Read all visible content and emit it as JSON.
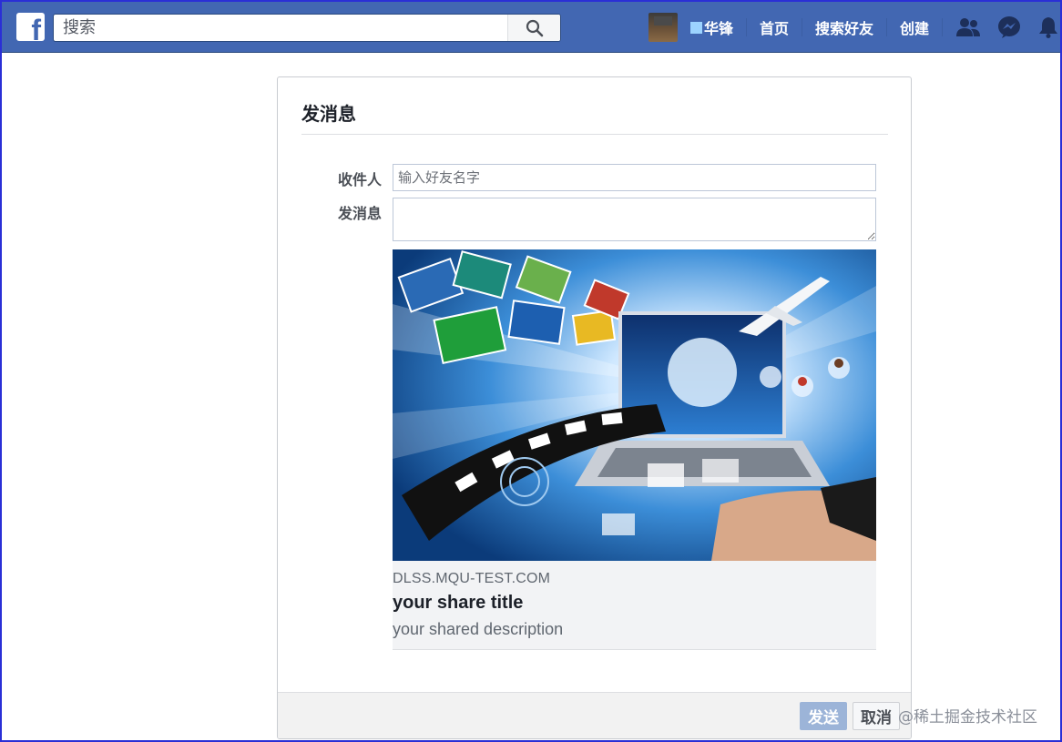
{
  "topbar": {
    "logo": "f",
    "search_placeholder": "搜索",
    "profile_name": "华锋",
    "nav": {
      "home": "首页",
      "find_friends": "搜索好友",
      "create": "创建"
    },
    "icons": {
      "search": "search-icon",
      "friends": "friends-icon",
      "messenger": "messenger-icon",
      "notifications": "bell-icon"
    }
  },
  "dialog": {
    "title": "发消息",
    "recipient_label": "收件人",
    "recipient_placeholder": "输入好友名字",
    "message_label": "发消息",
    "message_value": "",
    "share": {
      "domain": "DLSS.MQU-TEST.COM",
      "title": "your share title",
      "description": "your shared description"
    },
    "send_label": "发送",
    "cancel_label": "取消"
  },
  "watermark": "@稀土掘金技术社区",
  "colors": {
    "brand_blue": "#4267b2",
    "send_button_disabled": "#9cb4d8",
    "footer_bg": "#f2f2f2"
  }
}
